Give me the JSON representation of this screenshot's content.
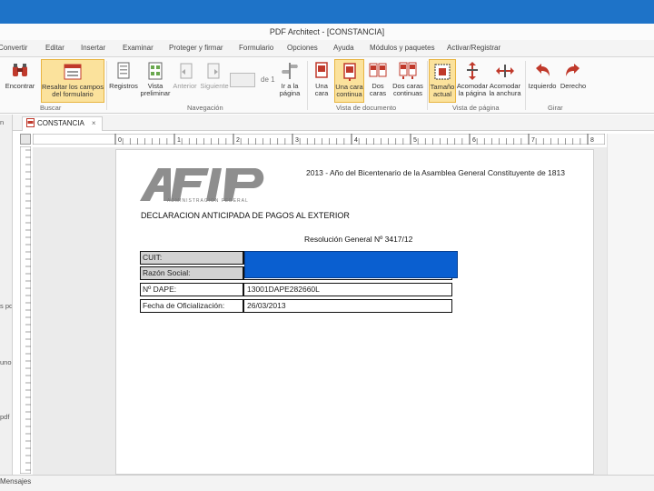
{
  "window": {
    "title": "PDF Architect - [CONSTANCIA]"
  },
  "menu": [
    "Convertir",
    "Editar",
    "Insertar",
    "Examinar",
    "Proteger y firmar",
    "Formulario",
    "Opciones",
    "Ayuda",
    "Módulos y paquetes",
    "Activar/Registrar"
  ],
  "ribbon": {
    "buttons": [
      {
        "label": "Encontrar",
        "icon": "binoculars-icon"
      },
      {
        "label": "Resaltar los campos del formulario",
        "icon": "form-fields-icon",
        "active": true
      },
      {
        "label": "Registros",
        "icon": "records-icon"
      },
      {
        "label": "Vista preliminar",
        "icon": "preview-icon"
      },
      {
        "label": "Anterior",
        "icon": "previous-page-icon"
      },
      {
        "label": "Siguiente",
        "icon": "next-page-icon"
      },
      {
        "label": "Ir a la página",
        "icon": "goto-page-icon"
      },
      {
        "label": "Una cara",
        "icon": "single-page-icon"
      },
      {
        "label": "Una cara continua",
        "icon": "single-continuous-icon",
        "active": true
      },
      {
        "label": "Dos caras",
        "icon": "two-pages-icon"
      },
      {
        "label": "Dos caras continuas",
        "icon": "two-continuous-icon"
      },
      {
        "label": "Tamaño actual",
        "icon": "actual-size-icon",
        "active": true
      },
      {
        "label": "Acomodar la página",
        "icon": "fit-page-icon"
      },
      {
        "label": "Acomodar la anchura",
        "icon": "fit-width-icon"
      },
      {
        "label": "Izquierdo",
        "icon": "rotate-left-icon"
      },
      {
        "label": "Derecho",
        "icon": "rotate-right-icon"
      }
    ],
    "page_of": "de 1",
    "groups": [
      "Buscar",
      "Navegación",
      "Vista de documento",
      "Vista de página",
      "Girar"
    ]
  },
  "tab": {
    "label": "CONSTANCIA"
  },
  "left_panel": {
    "top": "n",
    "fragments": [
      "s pdf",
      "uno",
      "pdf"
    ]
  },
  "ruler": {
    "marks": [
      "0",
      "1",
      "2",
      "3",
      "4",
      "5",
      "6",
      "7",
      "8"
    ]
  },
  "document": {
    "logo_subtitle": "ADMINISTRACION FEDERAL",
    "header_text": "2013 - Año del Bicentenario de la Asamblea General Constituyente de 1813",
    "title": "DECLARACION ANTICIPADA DE PAGOS AL EXTERIOR",
    "resolucion": "Resolución General Nº 3417/12",
    "fields": [
      {
        "label": "CUIT:",
        "value": ""
      },
      {
        "label": "Razón Social:",
        "value": ""
      },
      {
        "label": "Nº DAPE:",
        "value": "13001DAPE282660L"
      },
      {
        "label": "Fecha de Oficialización:",
        "value": "26/03/2013"
      }
    ]
  },
  "status": {
    "text": "Mensajes"
  },
  "colors": {
    "title_bar": "#1e73c8",
    "active_button": "#fbe29c",
    "redaction": "#0a5fd0",
    "label_gray": "#d2d2d2"
  }
}
